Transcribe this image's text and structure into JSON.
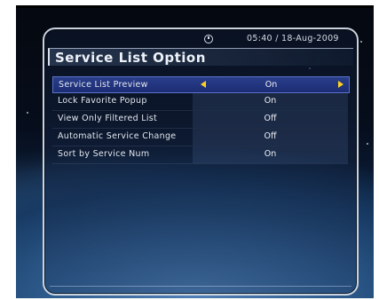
{
  "status": {
    "clock_icon": "clock-icon",
    "datetime": "05:40 / 18-Aug-2009"
  },
  "title": "Service List Option",
  "options": [
    {
      "label": "Service List Preview",
      "value": "On",
      "selected": true
    },
    {
      "label": "Lock Favorite Popup",
      "value": "On",
      "selected": false
    },
    {
      "label": "View Only Filtered List",
      "value": "Off",
      "selected": false
    },
    {
      "label": "Automatic Service Change",
      "value": "Off",
      "selected": false
    },
    {
      "label": "Sort by Service Num",
      "value": "On",
      "selected": false
    }
  ],
  "colors": {
    "selected_row": "#1f2f78",
    "arrow": "#ffd21f",
    "panel_border": "#c9d2df"
  },
  "icons": {
    "prev": "arrow-left-icon",
    "next": "arrow-right-icon"
  }
}
